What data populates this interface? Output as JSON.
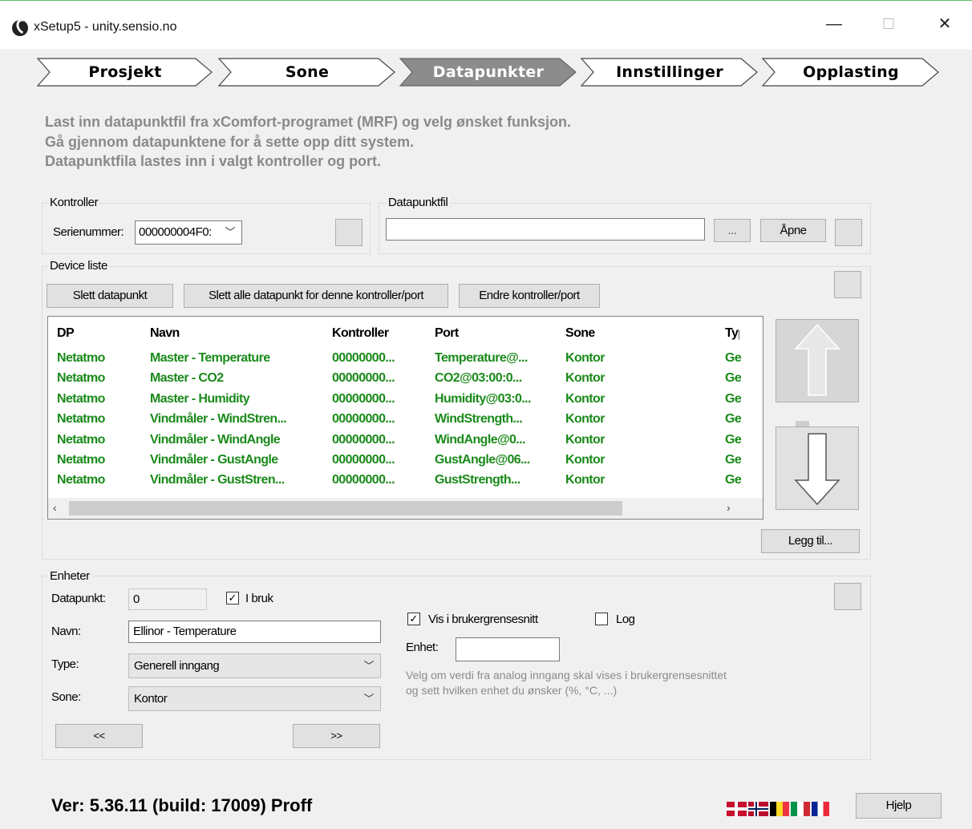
{
  "window": {
    "title": "xSetup5 - unity.sensio.no",
    "minimize": "—",
    "maximize": "☐",
    "close": "✕"
  },
  "steps": [
    {
      "label": "Prosjekt",
      "active": false
    },
    {
      "label": "Sone",
      "active": false
    },
    {
      "label": "Datapunkter",
      "active": true
    },
    {
      "label": "Innstillinger",
      "active": false
    },
    {
      "label": "Opplasting",
      "active": false
    }
  ],
  "intro": [
    "Last inn datapunktfil fra xComfort-programet (MRF) og velg ønsket funksjon.",
    "Gå gjennom datapunktene for å sette opp ditt system.",
    "Datapunktfila lastes inn i valgt kontroller og port."
  ],
  "kontroller": {
    "legend": "Kontroller",
    "serial_label": "Serienummer:",
    "serial_value": "000000004F0:"
  },
  "datapunktfil": {
    "legend": "Datapunktfil",
    "value": "",
    "browse": "...",
    "open": "Åpne"
  },
  "device_list": {
    "legend": "Device liste",
    "buttons": {
      "delete": "Slett datapunkt",
      "delete_all": "Slett alle datapunkt for denne kontroller/port",
      "change": "Endre kontroller/port",
      "add": "Legg til..."
    },
    "columns": [
      "DP",
      "Navn",
      "Kontroller",
      "Port",
      "Sone",
      "Typ"
    ],
    "rows": [
      [
        "Netatmo",
        "Master - Temperature",
        "00000000...",
        "Temperature@...",
        "Kontor",
        "Ge"
      ],
      [
        "Netatmo",
        "Master - CO2",
        "00000000...",
        "CO2@03:00:0...",
        "Kontor",
        "Ge"
      ],
      [
        "Netatmo",
        "Master - Humidity",
        "00000000...",
        "Humidity@03:0...",
        "Kontor",
        "Ge"
      ],
      [
        "Netatmo",
        "Vindmåler - WindStren...",
        "00000000...",
        "WindStrength...",
        "Kontor",
        "Ge"
      ],
      [
        "Netatmo",
        "Vindmåler - WindAngle",
        "00000000...",
        "WindAngle@0...",
        "Kontor",
        "Ge"
      ],
      [
        "Netatmo",
        "Vindmåler - GustAngle",
        "00000000...",
        "GustAngle@06...",
        "Kontor",
        "Ge"
      ],
      [
        "Netatmo",
        "Vindmåler - GustStren...",
        "00000000...",
        "GustStrength...",
        "Kontor",
        "Ge"
      ]
    ],
    "row_color": "#1a8a1a"
  },
  "enheter": {
    "legend": "Enheter",
    "datapunkt_label": "Datapunkt:",
    "datapunkt_value": "0",
    "i_bruk_label": "I bruk",
    "i_bruk_checked": true,
    "navn_label": "Navn:",
    "navn_value": "Ellinor - Temperature",
    "type_label": "Type:",
    "type_value": "Generell inngang",
    "sone_label": "Sone:",
    "sone_value": "Kontor",
    "prev": "<<",
    "next": ">>",
    "vis_label": "Vis i brukergrensesnitt",
    "vis_checked": true,
    "log_label": "Log",
    "log_checked": false,
    "enhet_label": "Enhet:",
    "enhet_value": "",
    "hint1": "Velg om verdi fra analog inngang skal vises i brukergrensesnittet",
    "hint2": "og sett hvilken enhet du ønsker (%, °C, ...)"
  },
  "footer": {
    "version": "Ver: 5.36.11 (build: 17009) Proff",
    "help": "Hjelp"
  }
}
